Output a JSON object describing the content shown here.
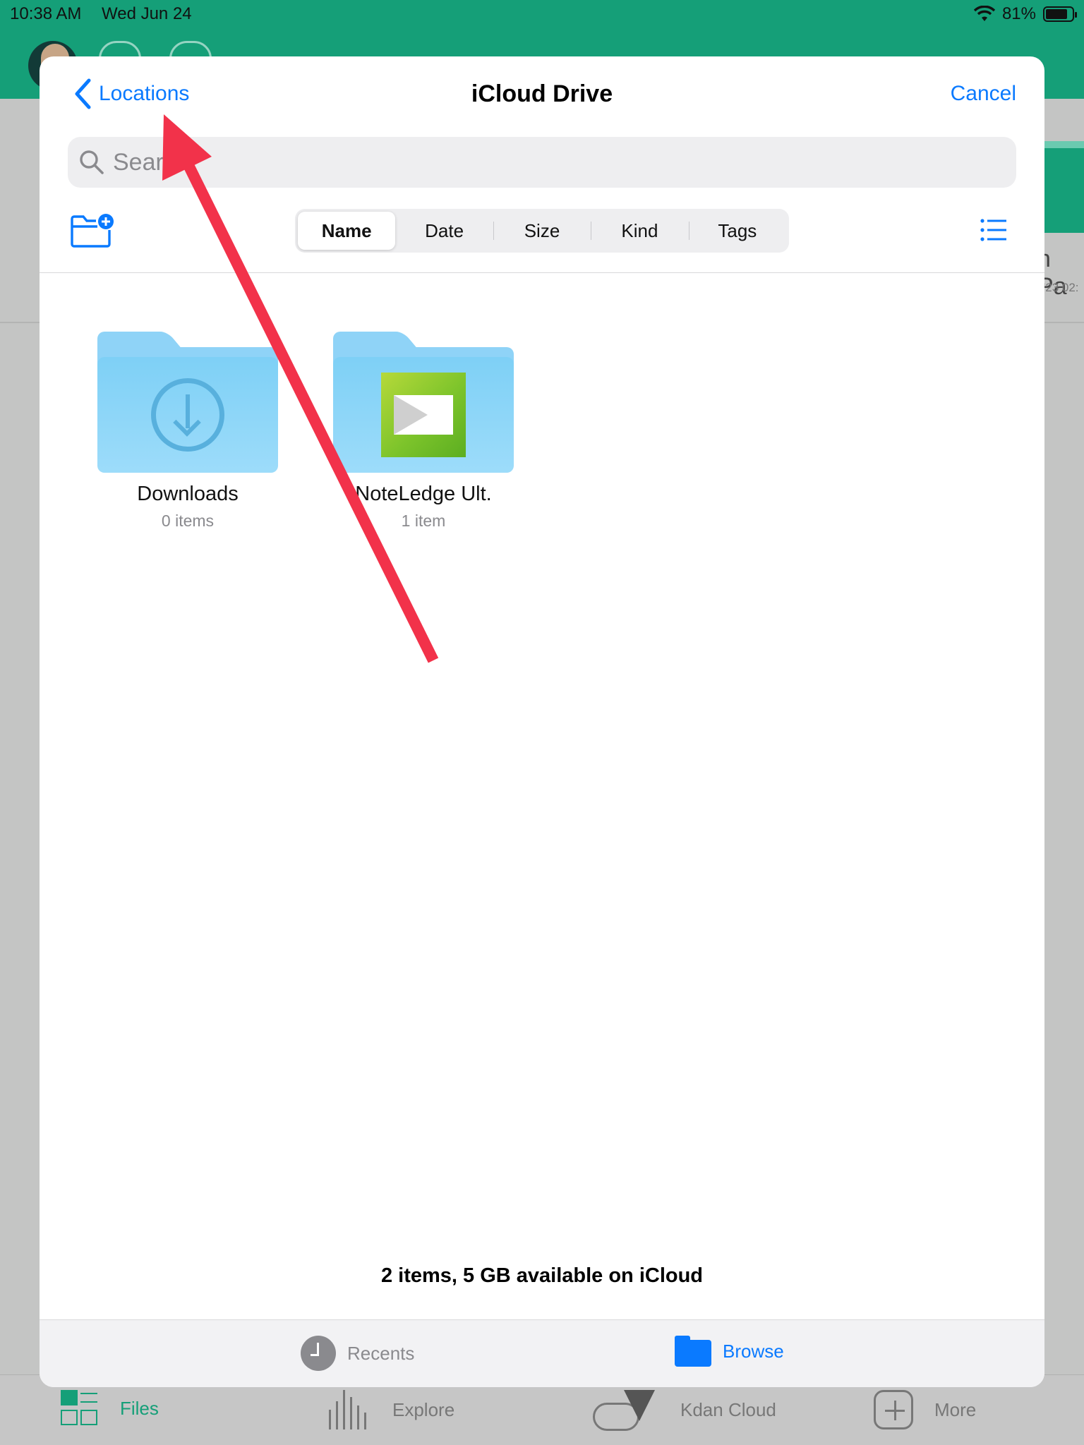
{
  "status_bar": {
    "time": "10:38 AM",
    "date": "Wed Jun 24",
    "battery": "81%"
  },
  "background_app": {
    "right_card_text": "h Pa",
    "right_card_date": "'23 02:",
    "tabs": [
      {
        "label": "Files",
        "icon": "grid-icon",
        "active": true
      },
      {
        "label": "Explore",
        "icon": "bars-icon",
        "active": false
      },
      {
        "label": "Kdan Cloud",
        "icon": "cloud-icon",
        "active": false
      },
      {
        "label": "More",
        "icon": "plus-box-icon",
        "active": false
      }
    ],
    "accent_color": "#159f78"
  },
  "sheet": {
    "back_label": "Locations",
    "title": "iCloud Drive",
    "cancel_label": "Cancel",
    "search_placeholder": "Search",
    "sort_options": [
      "Name",
      "Date",
      "Size",
      "Kind",
      "Tags"
    ],
    "selected_sort": "Name",
    "files": [
      {
        "name": "Downloads",
        "meta": "0 items",
        "icon": "download-folder-icon"
      },
      {
        "name": "NoteLedge Ult.",
        "meta": "1 item",
        "icon": "noteledge-folder-icon"
      }
    ],
    "summary": "2 items, 5 GB available on iCloud",
    "tabs": [
      {
        "label": "Recents",
        "icon": "clock-icon",
        "active": false
      },
      {
        "label": "Browse",
        "icon": "folder-icon",
        "active": true
      }
    ],
    "accent_color": "#0a7aff"
  },
  "annotation": {
    "type": "red-arrow",
    "points_to": "Locations",
    "color": "#f2324a"
  }
}
